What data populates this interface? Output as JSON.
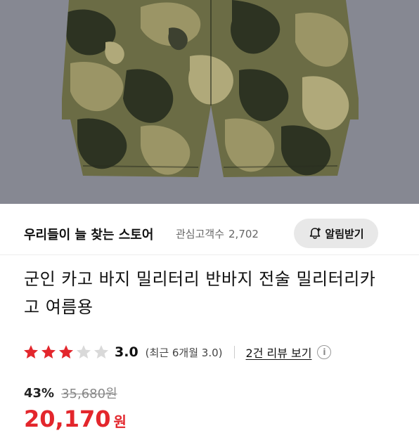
{
  "product_image": {
    "alt": "camouflage cargo shorts photo"
  },
  "store": {
    "name": "우리들이 늘 찾는 스토어",
    "follower_label": "관심고객수",
    "follower_count": "2,702",
    "alarm_button": "알림받기"
  },
  "product": {
    "title": "군인 카고 바지 밀리터리 반바지 전술 밀리터리카고 여름용"
  },
  "rating": {
    "stars": 3,
    "max": 5,
    "score": "3.0",
    "recent": "(최근 6개월 3.0)",
    "reviews_link": "2건 리뷰 보기",
    "info_icon": "i"
  },
  "price": {
    "discount": "43%",
    "original": "35,680원",
    "sale": "20,170",
    "currency": "원"
  },
  "colors": {
    "accent_red": "#e3262c",
    "star_filled": "#e3262c",
    "star_empty": "#d9d9d9",
    "camo_dark": "#2d3322",
    "camo_olive": "#6b6c45",
    "camo_khaki": "#9b9566",
    "photo_background": "#8a8d95"
  }
}
